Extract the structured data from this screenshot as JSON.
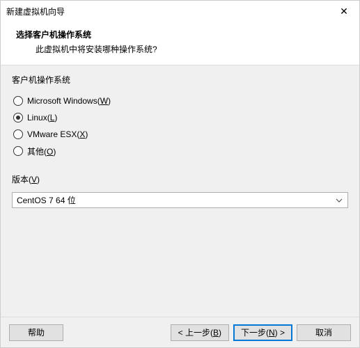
{
  "window": {
    "title": "新建虚拟机向导",
    "close_glyph": "✕"
  },
  "header": {
    "heading": "选择客户机操作系统",
    "subheading": "此虚拟机中将安装哪种操作系统?"
  },
  "os_group": {
    "label": "客户机操作系统",
    "options": [
      {
        "label_pre": "Microsoft Windows(",
        "mnemonic": "W",
        "label_post": ")",
        "selected": false
      },
      {
        "label_pre": "Linux(",
        "mnemonic": "L",
        "label_post": ")",
        "selected": true
      },
      {
        "label_pre": "VMware ESX(",
        "mnemonic": "X",
        "label_post": ")",
        "selected": false
      },
      {
        "label_pre": "其他(",
        "mnemonic": "O",
        "label_post": ")",
        "selected": false
      }
    ]
  },
  "version": {
    "label_pre": "版本(",
    "mnemonic": "V",
    "label_post": ")",
    "selected_value": "CentOS 7 64 位"
  },
  "buttons": {
    "help": "帮助",
    "back_pre": "< 上一步(",
    "back_mnemonic": "B",
    "back_post": ")",
    "next_pre": "下一步(",
    "next_mnemonic": "N",
    "next_post": ") >",
    "cancel": "取消"
  }
}
